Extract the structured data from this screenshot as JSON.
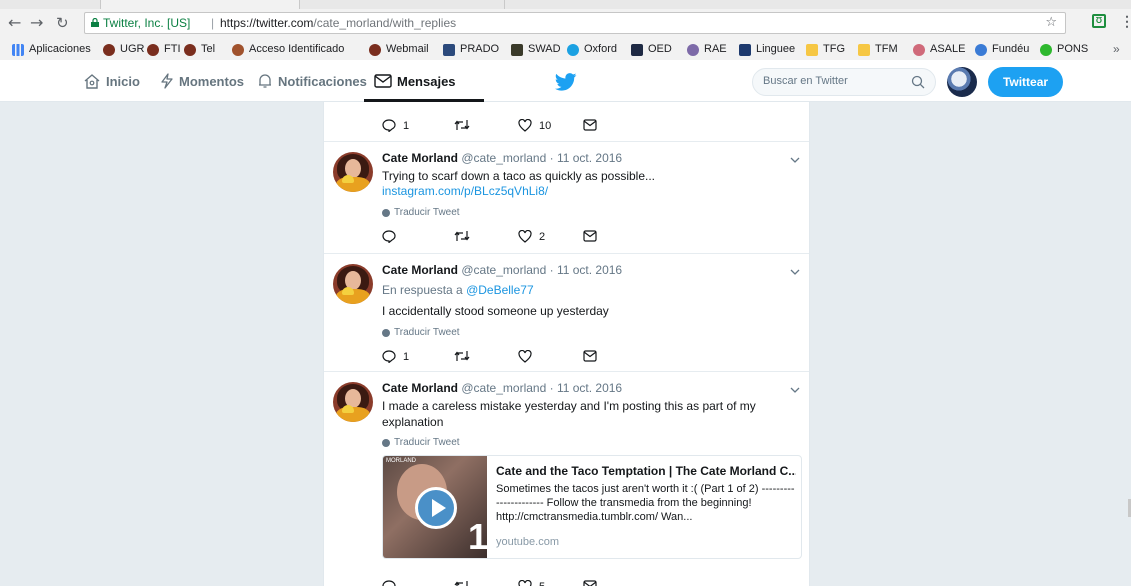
{
  "browser": {
    "secure_label": "Twitter, Inc. [US]",
    "separator": "|",
    "url_host": "https://twitter.com",
    "url_path": "/cate_morland/with_replies",
    "bookmarks": [
      "Aplicaciones",
      "UGR",
      "FTI",
      "Tel",
      "Acceso Identificado",
      "Webmail",
      "PRADO",
      "SWAD",
      "Oxford",
      "OED",
      "RAE",
      "Linguee",
      "TFG",
      "TFM",
      "ASALE",
      "Fundéu",
      "PONS"
    ],
    "bookmarks_more": "»",
    "colors": {
      "secure": "#0b8043"
    }
  },
  "nav": {
    "home": "Inicio",
    "moments": "Momentos",
    "notifications": "Notificaciones",
    "messages": "Mensajes",
    "search_placeholder": "Buscar en Twitter",
    "tweet_button": "Twittear",
    "colors": {
      "brand": "#1da1f2"
    }
  },
  "tweets": [
    {
      "actions": {
        "replies": "1",
        "retweets": "",
        "likes": "10"
      }
    },
    {
      "name": "Cate Morland",
      "handle": "@cate_morland",
      "dot": "·",
      "date": "11 oct. 2016",
      "text": "Trying to scarf down a taco as quickly as possible...",
      "link": "instagram.com/p/BLcz5qVhLi8/",
      "translate": "Traducir Tweet",
      "actions": {
        "replies": "",
        "retweets": "",
        "likes": "2"
      }
    },
    {
      "name": "Cate Morland",
      "handle": "@cate_morland",
      "dot": "·",
      "date": "11 oct. 2016",
      "reply_prefix": "En respuesta a",
      "reply_to": "@DeBelle77",
      "text": "I accidentally stood someone up yesterday",
      "translate": "Traducir Tweet",
      "actions": {
        "replies": "1",
        "retweets": "",
        "likes": ""
      }
    },
    {
      "name": "Cate Morland",
      "handle": "@cate_morland",
      "dot": "·",
      "date": "11 oct. 2016",
      "text": "I made a careless mistake yesterday and I'm posting this as part of my explanation",
      "translate": "Traducir Tweet",
      "card": {
        "title": "Cate and the Taco Temptation | The Cate Morland C...",
        "description": "Sometimes the tacos just aren't worth it :( (Part 1 of 2) ---------------------- Follow the transmedia from the beginning! http://cmctransmedia.tumblr.com/ Wan...",
        "domain": "youtube.com",
        "thumb_number": "1",
        "thumb_brand": "MORLAND"
      },
      "actions": {
        "replies": "",
        "retweets": "",
        "likes": "5"
      }
    }
  ]
}
